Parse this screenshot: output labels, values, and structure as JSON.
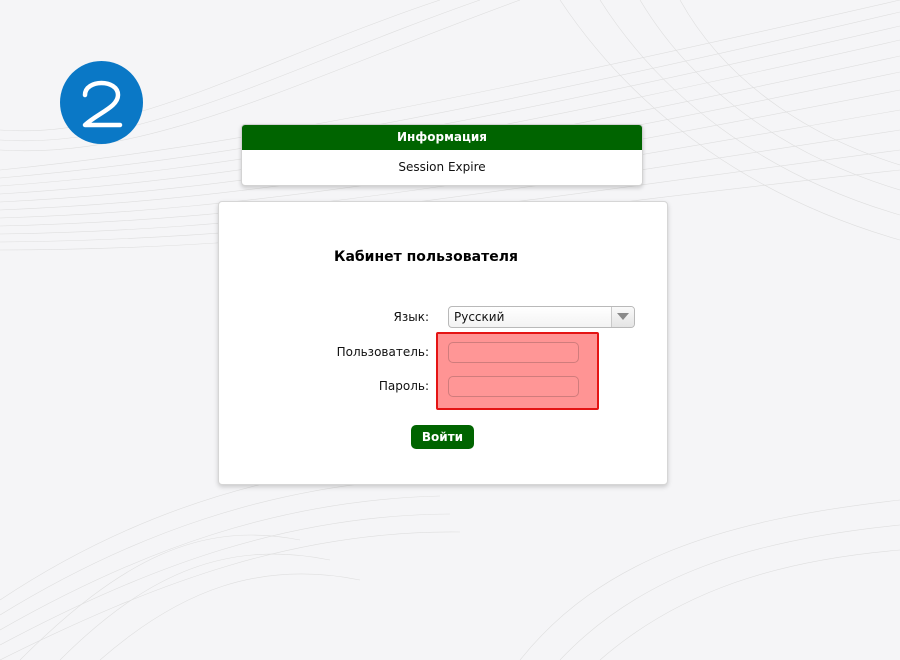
{
  "step": {
    "number": "2",
    "color": "#0a78c6"
  },
  "info": {
    "header": "Информация",
    "message": "Session Expire",
    "header_color": "#006400"
  },
  "login": {
    "title": "Кабинет пользователя",
    "language_label": "Язык:",
    "language_value": "Русский",
    "user_label": "Пользователь:",
    "user_value": "",
    "password_label": "Пароль:",
    "password_value": "",
    "submit_label": "Войти",
    "submit_color": "#006400"
  },
  "highlight": {
    "fill_color": "#ff9494",
    "border_color": "#e41414"
  }
}
